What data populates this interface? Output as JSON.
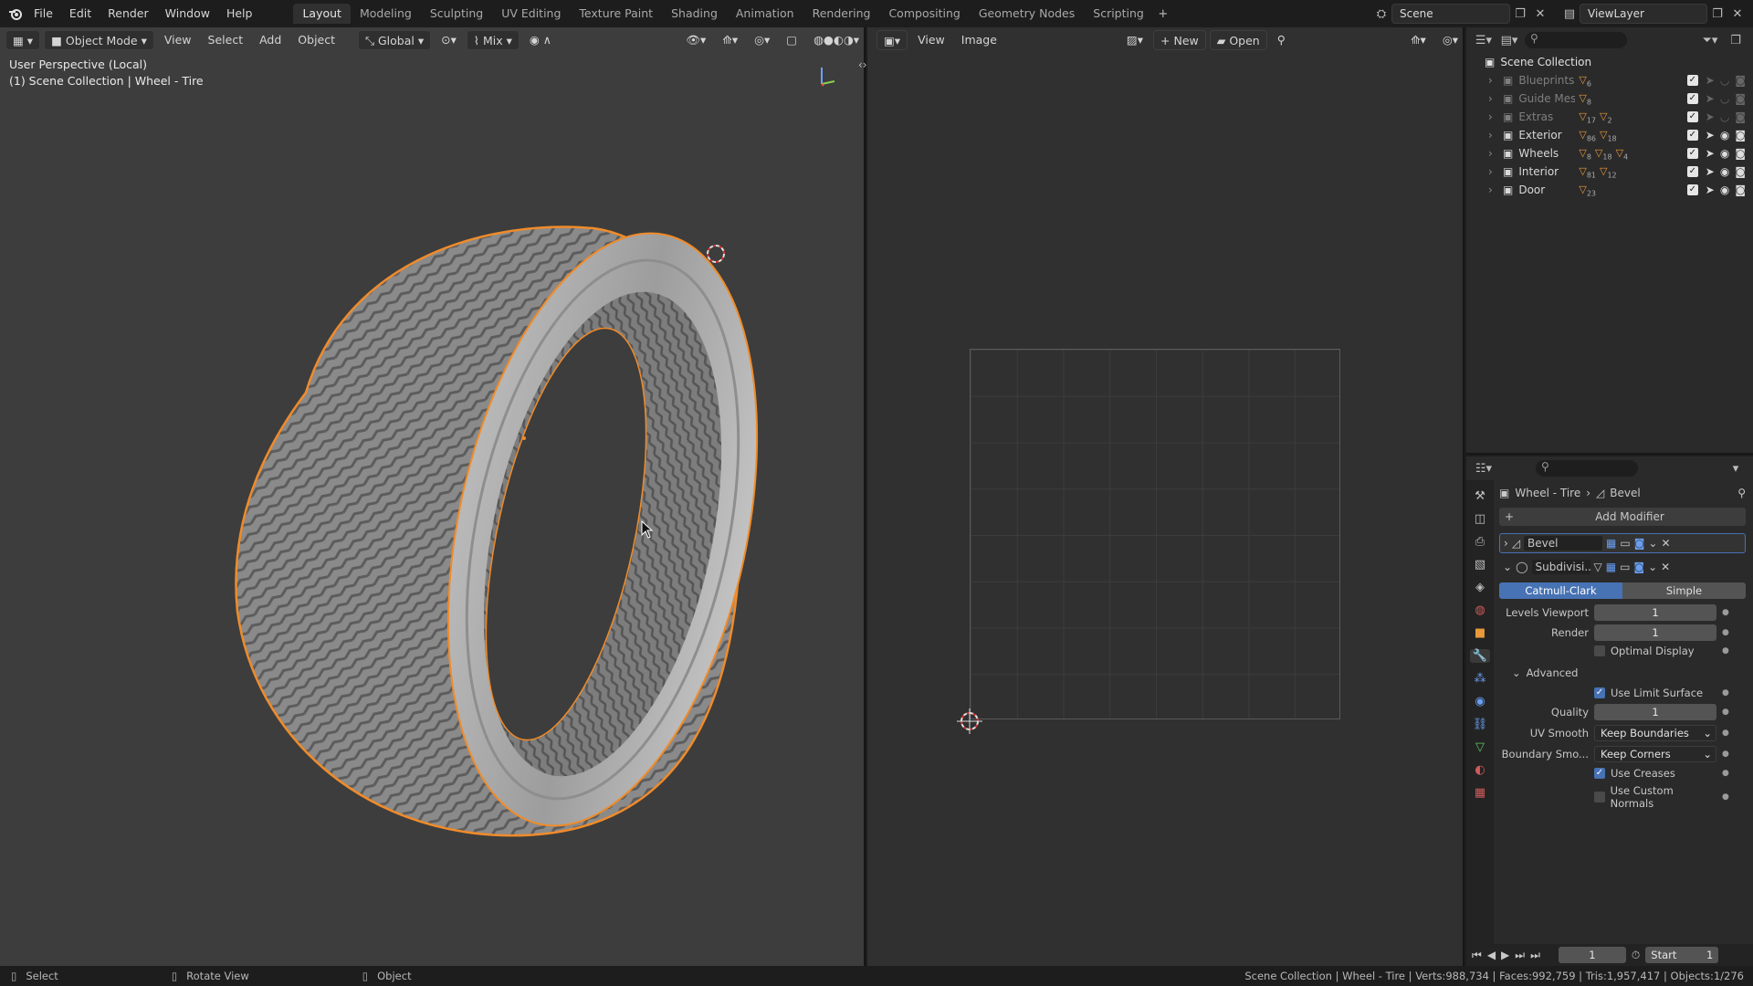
{
  "menu": [
    "File",
    "Edit",
    "Render",
    "Window",
    "Help"
  ],
  "workspaces": [
    "Layout",
    "Modeling",
    "Sculpting",
    "UV Editing",
    "Texture Paint",
    "Shading",
    "Animation",
    "Rendering",
    "Compositing",
    "Geometry Nodes",
    "Scripting"
  ],
  "active_workspace": "Layout",
  "scene_name": "Scene",
  "view_layer": "ViewLayer",
  "viewport": {
    "mode": "Object Mode",
    "menus": [
      "View",
      "Select",
      "Add",
      "Object"
    ],
    "transform_orientation": "Global",
    "snap_mode": "Mix",
    "info_line1": "User Perspective (Local)",
    "info_line2": "(1) Scene Collection | Wheel - Tire"
  },
  "image_editor": {
    "menus": [
      "View",
      "Image"
    ],
    "new_label": "New",
    "open_label": "Open"
  },
  "outliner": {
    "root": "Scene Collection",
    "items": [
      {
        "name": "Blueprints",
        "count1": "6",
        "dim": true
      },
      {
        "name": "Guide Meshes",
        "count1": "8",
        "dim": true
      },
      {
        "name": "Extras",
        "count1": "17",
        "count2": "2",
        "dim": true
      },
      {
        "name": "Exterior",
        "count1": "86",
        "count2": "18",
        "dim": false
      },
      {
        "name": "Wheels",
        "count1": "8",
        "count2": "18",
        "count3": "4",
        "dim": false
      },
      {
        "name": "Interior",
        "count1": "81",
        "count2": "12",
        "dim": false
      },
      {
        "name": "Door",
        "count1": "23",
        "dim": false
      }
    ]
  },
  "properties": {
    "breadcrumb_object": "Wheel - Tire",
    "breadcrumb_modifier": "Bevel",
    "add_modifier": "Add Modifier",
    "mod1_name": "Bevel",
    "mod2_name": "Subdivisi...",
    "mode_catmull": "Catmull-Clark",
    "mode_simple": "Simple",
    "levels_viewport_label": "Levels Viewport",
    "levels_viewport_value": "1",
    "render_label": "Render",
    "render_value": "1",
    "optimal_display": "Optimal Display",
    "advanced": "Advanced",
    "use_limit_surface": "Use Limit Surface",
    "quality_label": "Quality",
    "quality_value": "1",
    "uv_smooth_label": "UV Smooth",
    "uv_smooth_value": "Keep Boundaries",
    "boundary_label": "Boundary Smo...",
    "boundary_value": "Keep Corners",
    "use_creases": "Use Creases",
    "use_custom_normals": "Use Custom Normals"
  },
  "timeline": {
    "frame": "1",
    "start_label": "Start",
    "start_value": "1"
  },
  "statusbar": {
    "select": "Select",
    "rotate": "Rotate View",
    "object": "Object",
    "stats": "Scene Collection | Wheel - Tire | Verts:988,734 | Faces:992,759 | Tris:1,957,417 | Objects:1/276"
  },
  "colors": {
    "accent_blue": "#4772b3",
    "selection_orange": "#f08b2a",
    "viewport_bg": "#3d3d3d"
  }
}
